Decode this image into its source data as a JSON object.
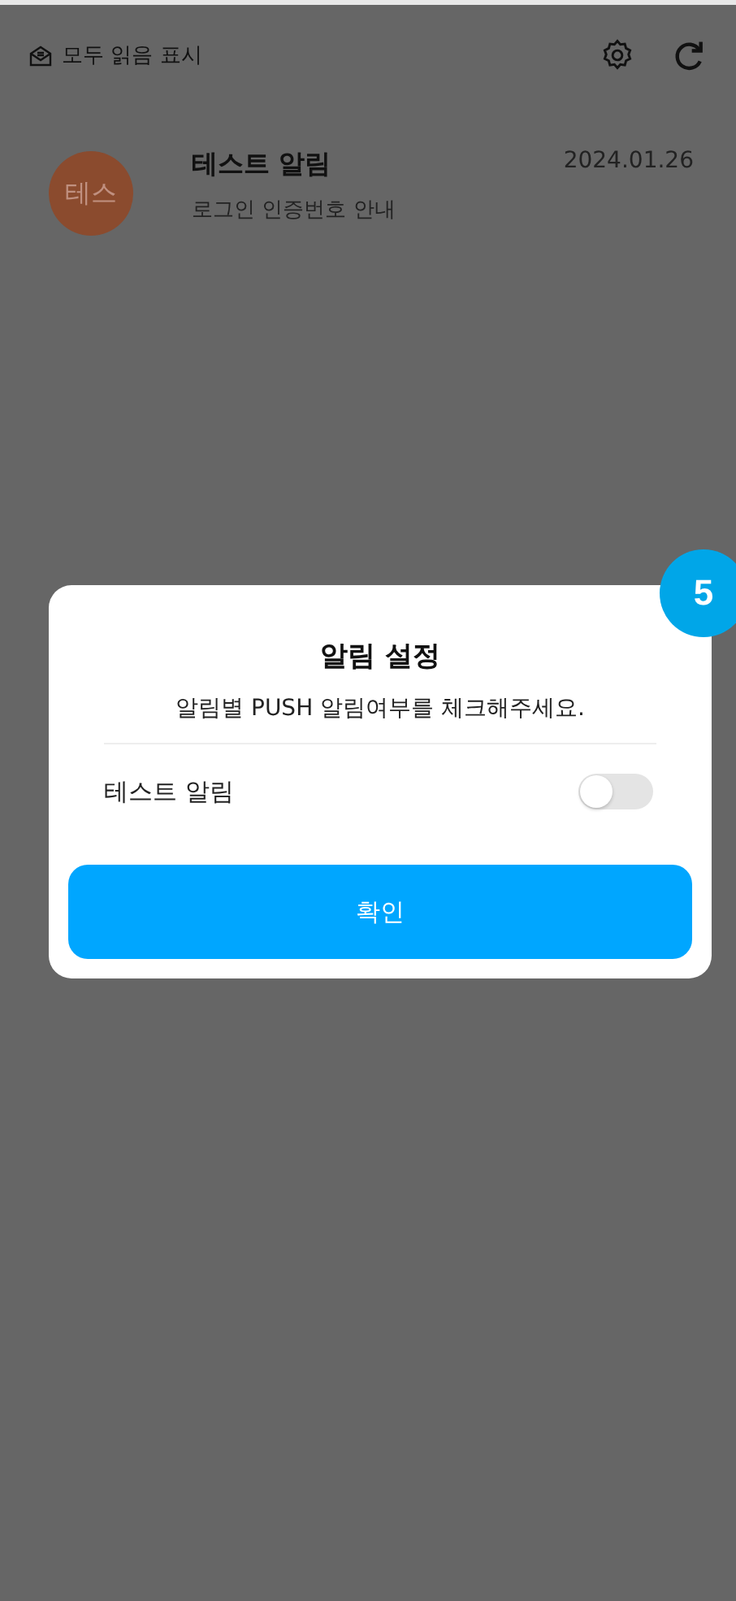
{
  "header": {
    "mark_all_read": "모두 읽음 표시"
  },
  "notifications": [
    {
      "avatar": "테스",
      "title": "테스트 알림",
      "date": "2024.01.26",
      "body": "로그인 인증번호 안내"
    }
  ],
  "dialog": {
    "title": "알림 설정",
    "subtitle": "알림별 PUSH 알림여부를 체크해주세요.",
    "settings": [
      {
        "label": "테스트 알림",
        "on": false
      }
    ],
    "confirm": "확인",
    "step_badge": "5"
  }
}
